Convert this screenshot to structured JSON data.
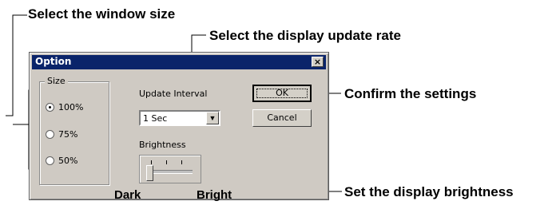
{
  "callouts": {
    "window_size": "Select the window size",
    "update_rate": "Select the display update rate",
    "confirm": "Confirm the settings",
    "brightness": "Set the display brightness",
    "dark": "Dark",
    "bright": "Bright"
  },
  "dialog": {
    "title": "Option",
    "close_glyph": "×",
    "size_group": {
      "legend": "Size",
      "options": [
        "100%",
        "75%",
        "50%"
      ],
      "selected": "100%"
    },
    "update_interval": {
      "label": "Update Interval",
      "value": "1 Sec"
    },
    "brightness": {
      "label": "Brightness",
      "level": 0
    },
    "buttons": {
      "ok": "OK",
      "cancel": "Cancel"
    }
  }
}
